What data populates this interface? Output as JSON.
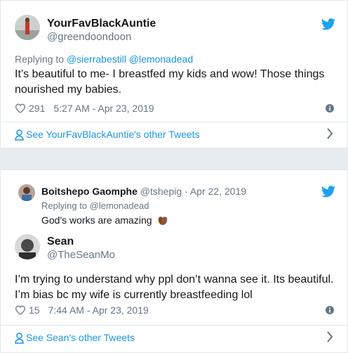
{
  "tweet1": {
    "name": "YourFavBlackAuntie",
    "handle": "@greendoondoon",
    "reply_prefix": "Replying to",
    "reply_to": "@sierrabestill @lemonadead",
    "text": "It’s beautiful to me- I breastfed my kids and wow! Those things nourished my babies.",
    "likes": "291",
    "timestamp": "5:27 AM - Apr 23, 2019",
    "other_tweets": "See YourFavBlackAuntie's other Tweets"
  },
  "tweet2": {
    "quoted": {
      "name": "Boitshepo Gaomphe",
      "handle": "@tshepig",
      "separator": "·",
      "date": "Apr 22, 2019",
      "reply_prefix": "Replying to",
      "reply_to": "@lemonadead",
      "text": "God's works are amazing"
    },
    "name": "Sean",
    "handle": "@TheSeanMo",
    "text_line1": "I’m trying to understand why ppl don’t wanna see it. Its beautiful.",
    "text_line2": "I’m bias bc my wife is currently breastfeeding lol",
    "likes": "15",
    "timestamp": "7:44 AM - Apr 23, 2019",
    "other_tweets": "See Sean's other Tweets"
  },
  "icons": [
    "twitter-bird-icon",
    "heart-icon",
    "info-icon",
    "user-icon",
    "chevron-right-icon",
    "praying-hands-emoji"
  ],
  "colors": {
    "accent": "#1b95e0",
    "bird": "#1da1f2",
    "muted": "#657786",
    "border": "#e1e8ed"
  }
}
